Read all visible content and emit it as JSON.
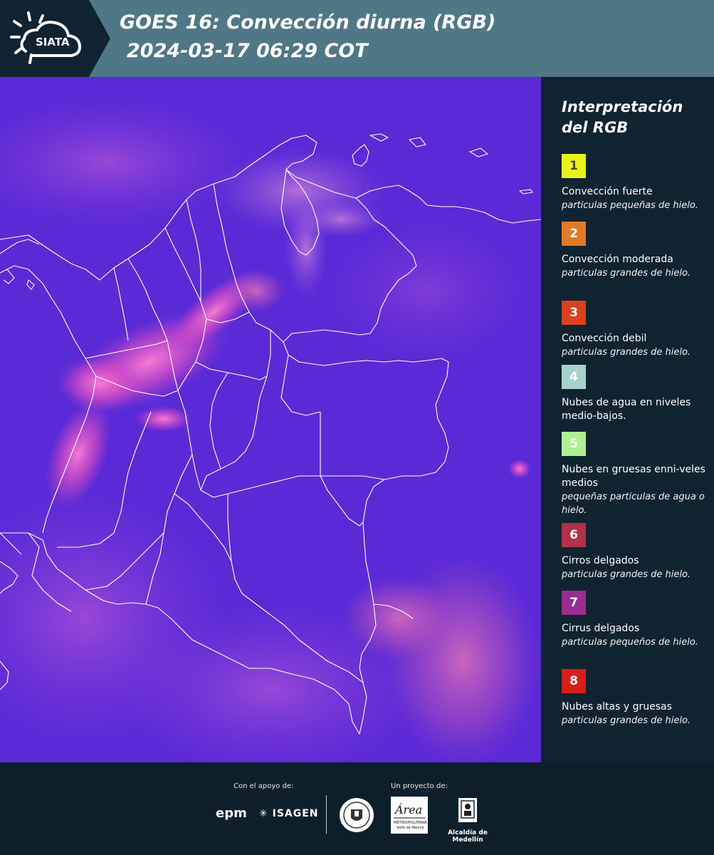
{
  "header": {
    "logo_text": "SIATA",
    "title_line1": "GOES 16: Convección diurna (RGB)",
    "title_line2": "2024-03-17 06:29 COT"
  },
  "legend": {
    "title_line1": "Interpretación",
    "title_line2": "del RGB",
    "items": [
      {
        "number": "1",
        "color": "#e9f21a",
        "text_color": "#4a4a00",
        "title": "Convección fuerte",
        "description": "particulas pequeñas de hielo."
      },
      {
        "number": "2",
        "color": "#e07a28",
        "text_color": "#ffffff",
        "title": "Convección moderada",
        "description": "particulas grandes de hielo."
      },
      {
        "number": "3",
        "color": "#d94020",
        "text_color": "#ffffff",
        "title": "Convección debil",
        "description": "particulas grandes de hielo."
      },
      {
        "number": "4",
        "color": "#a7d2cc",
        "text_color": "#ffffff",
        "title": "Nubes de agua en niveles medio-bajos.",
        "description": ""
      },
      {
        "number": "5",
        "color": "#aef092",
        "text_color": "#ffffff",
        "title": "Nubes en gruesas enni-veles medios",
        "description": "pequeñas particulas de agua o hielo."
      },
      {
        "number": "6",
        "color": "#b2304a",
        "text_color": "#ffffff",
        "title": "Cirros delgados",
        "description": "particulas grandes de hielo."
      },
      {
        "number": "7",
        "color": "#9b2c92",
        "text_color": "#ffffff",
        "title": "Cirrus delgados",
        "description": "particulas pequeños de hielo."
      },
      {
        "number": "8",
        "color": "#d61f16",
        "text_color": "#ffffff",
        "title": "Nubes altas y gruesas",
        "description": "particulas grandes de hielo."
      }
    ]
  },
  "map": {
    "base_color": "#5a2ad6",
    "convection_color": "#ff5fc8"
  },
  "footer": {
    "support_label": "Con el apoyo de:",
    "project_label": "Un proyecto de:",
    "sponsor1": "epm",
    "sponsor2": "ISAGEN",
    "partner_area_line1": "Área",
    "partner_area_line2": "METROPOLITANA",
    "partner_area_line3": "Valle de Aburrá",
    "partner_medellin": "Alcaldía de Medellín"
  }
}
